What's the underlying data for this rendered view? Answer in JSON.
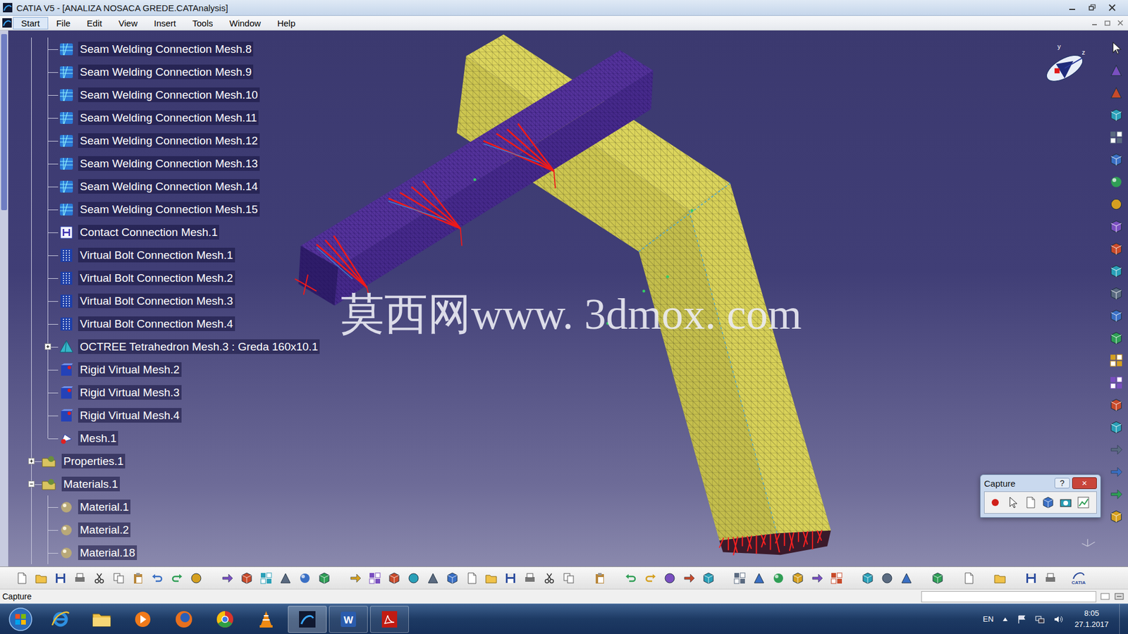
{
  "window": {
    "title": "CATIA V5 - [ANALIZA NOSACA GREDE.CATAnalysis]"
  },
  "menu": [
    {
      "label": "Start",
      "selected": true
    },
    {
      "label": "File",
      "selected": false
    },
    {
      "label": "Edit",
      "selected": false
    },
    {
      "label": "View",
      "selected": false
    },
    {
      "label": "Insert",
      "selected": false
    },
    {
      "label": "Tools",
      "selected": false
    },
    {
      "label": "Window",
      "selected": false
    },
    {
      "label": "Help",
      "selected": false
    }
  ],
  "tree": [
    {
      "label": "Seam Welding Connection Mesh.8",
      "kind": "seam-weld",
      "depth": 2
    },
    {
      "label": "Seam Welding Connection Mesh.9",
      "kind": "seam-weld",
      "depth": 2
    },
    {
      "label": "Seam Welding Connection Mesh.10",
      "kind": "seam-weld",
      "depth": 2
    },
    {
      "label": "Seam Welding Connection Mesh.11",
      "kind": "seam-weld",
      "depth": 2
    },
    {
      "label": "Seam Welding Connection Mesh.12",
      "kind": "seam-weld",
      "depth": 2
    },
    {
      "label": "Seam Welding Connection Mesh.13",
      "kind": "seam-weld",
      "depth": 2
    },
    {
      "label": "Seam Welding Connection Mesh.14",
      "kind": "seam-weld",
      "depth": 2
    },
    {
      "label": "Seam Welding Connection Mesh.15",
      "kind": "seam-weld",
      "depth": 2
    },
    {
      "label": "Contact Connection Mesh.1",
      "kind": "contact",
      "depth": 2
    },
    {
      "label": "Virtual Bolt Connection Mesh.1",
      "kind": "bolt",
      "depth": 2
    },
    {
      "label": "Virtual Bolt Connection Mesh.2",
      "kind": "bolt",
      "depth": 2
    },
    {
      "label": "Virtual Bolt Connection Mesh.3",
      "kind": "bolt",
      "depth": 2
    },
    {
      "label": "Virtual Bolt Connection Mesh.4",
      "kind": "bolt",
      "depth": 2
    },
    {
      "label": "OCTREE Tetrahedron Mesh.3 : Greda 160x10.1",
      "kind": "octree",
      "depth": 2,
      "expanded": false
    },
    {
      "label": "Rigid Virtual Mesh.2",
      "kind": "rigid",
      "depth": 2
    },
    {
      "label": "Rigid Virtual Mesh.3",
      "kind": "rigid",
      "depth": 2
    },
    {
      "label": "Rigid Virtual Mesh.4",
      "kind": "rigid",
      "depth": 2
    },
    {
      "label": "Mesh.1",
      "kind": "mesh",
      "depth": 2
    },
    {
      "label": "Properties.1",
      "kind": "folder",
      "depth": 1,
      "expanded": false
    },
    {
      "label": "Materials.1",
      "kind": "folder",
      "depth": 1,
      "expanded": true
    },
    {
      "label": "Material.1",
      "kind": "material",
      "depth": 2
    },
    {
      "label": "Material.2",
      "kind": "material",
      "depth": 2
    },
    {
      "label": "Material.18",
      "kind": "material",
      "depth": 2
    }
  ],
  "watermark": "莫西网www. 3dmox. com",
  "compass": {
    "axes": [
      "y",
      "z"
    ]
  },
  "capture_dialog": {
    "title": "Capture",
    "help": "?",
    "close": "×"
  },
  "status_bar": {
    "text": "Capture"
  },
  "brand": "CATIA",
  "taskbar": {
    "apps": [
      {
        "kind": "ie",
        "open": false,
        "selected": false
      },
      {
        "kind": "explorer",
        "open": false,
        "selected": false
      },
      {
        "kind": "media",
        "open": false,
        "selected": false
      },
      {
        "kind": "firefox",
        "open": false,
        "selected": false
      },
      {
        "kind": "chrome",
        "open": false,
        "selected": false
      },
      {
        "kind": "vlc",
        "open": false,
        "selected": false
      },
      {
        "kind": "catia",
        "open": true,
        "selected": true
      },
      {
        "kind": "word",
        "label": "W",
        "open": true,
        "selected": false
      },
      {
        "kind": "acrobat",
        "open": true,
        "selected": false
      }
    ],
    "language": "EN",
    "time": "8:05",
    "date": "27.1.2017"
  }
}
